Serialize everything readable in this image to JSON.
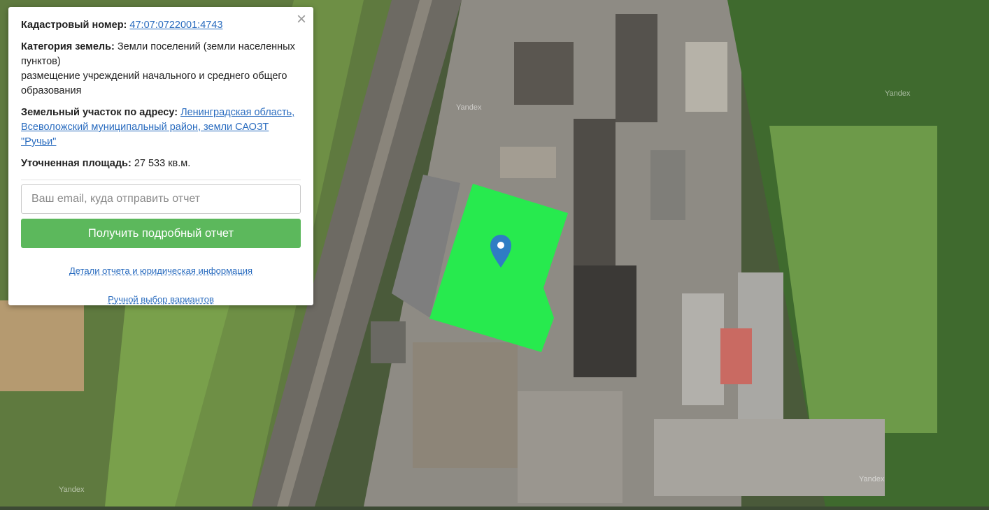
{
  "info": {
    "cadastral_label": "Кадастровый номер:",
    "cadastral_number": "47:07:0722001:4743",
    "category_label": "Категория земель:",
    "category_value": "Земли поселений (земли населенных пунктов)",
    "category_use": "размещение учреждений начального и среднего общего образования",
    "address_label": "Земельный участок по адресу:",
    "address_value": "Ленинградская область, Всеволожский муниципальный район, земли САОЗТ \"Ручьи\"",
    "area_label": "Уточненная площадь:",
    "area_value": "27 533 кв.м."
  },
  "form": {
    "email_placeholder": "Ваш email, куда отправить отчет",
    "submit_label": "Получить подробный отчет",
    "details_link": "Детали отчета и юридическая информация",
    "manual_link": "Ручной выбор вариантов",
    "close_symbol": "×"
  },
  "map": {
    "watermark": "Yandex",
    "parcel_color": "#1ef24a",
    "marker_color": "#2f7dc4"
  }
}
